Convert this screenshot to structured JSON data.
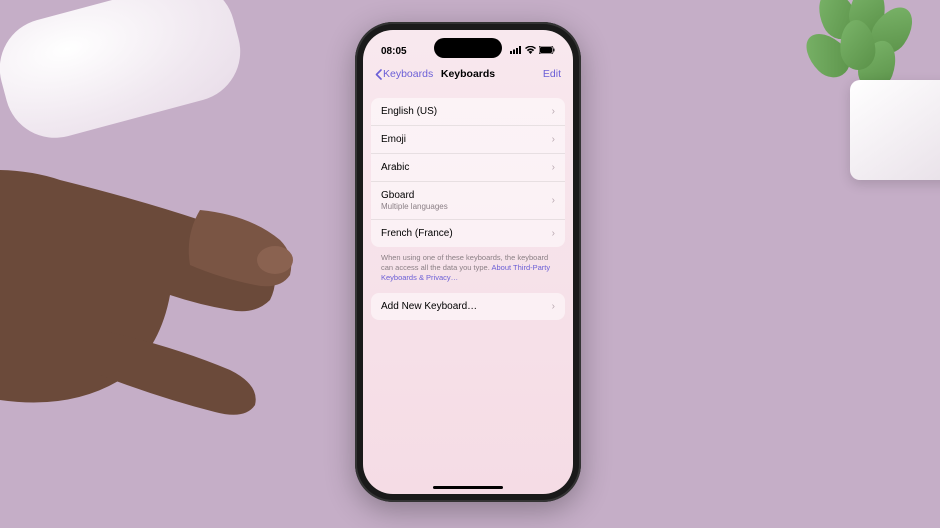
{
  "status": {
    "time": "08:05"
  },
  "nav": {
    "back_label": "Keyboards",
    "title": "Keyboards",
    "edit_label": "Edit"
  },
  "keyboards": [
    {
      "label": "English (US)",
      "subtitle": ""
    },
    {
      "label": "Emoji",
      "subtitle": ""
    },
    {
      "label": "Arabic",
      "subtitle": ""
    },
    {
      "label": "Gboard",
      "subtitle": "Multiple languages"
    },
    {
      "label": "French (France)",
      "subtitle": ""
    }
  ],
  "footer": {
    "text": "When using one of these keyboards, the keyboard can access all the data you type. ",
    "link": "About Third-Party Keyboards & Privacy…"
  },
  "add": {
    "label": "Add New Keyboard…"
  }
}
